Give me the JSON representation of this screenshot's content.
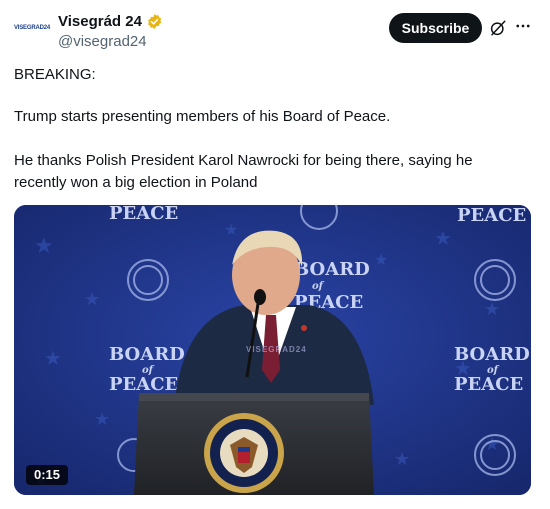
{
  "account": {
    "avatar_text": "VISEGRAD24",
    "display_name": "Visegrád 24",
    "handle": "@visegrad24",
    "verified": true
  },
  "actions": {
    "subscribe_label": "Subscribe",
    "grok_icon": "grok-icon",
    "more_icon": "more-icon"
  },
  "post": {
    "line1": "BREAKING:",
    "line2": "Trump starts presenting members of his Board of Peace.",
    "line3": "He thanks Polish President Karol Nawrocki for being there, saying he recently won a big election in Poland"
  },
  "video": {
    "duration": "0:15",
    "watermark": "VISEGRAD24",
    "backdrop_text": {
      "peace": "PEACE",
      "board": "BOARD",
      "of": "of"
    }
  },
  "colors": {
    "subscribe_bg": "#0f1419",
    "verified_gold": "#e8b518",
    "handle_gray": "#536471",
    "backdrop_blue": "#1c2f7c"
  }
}
